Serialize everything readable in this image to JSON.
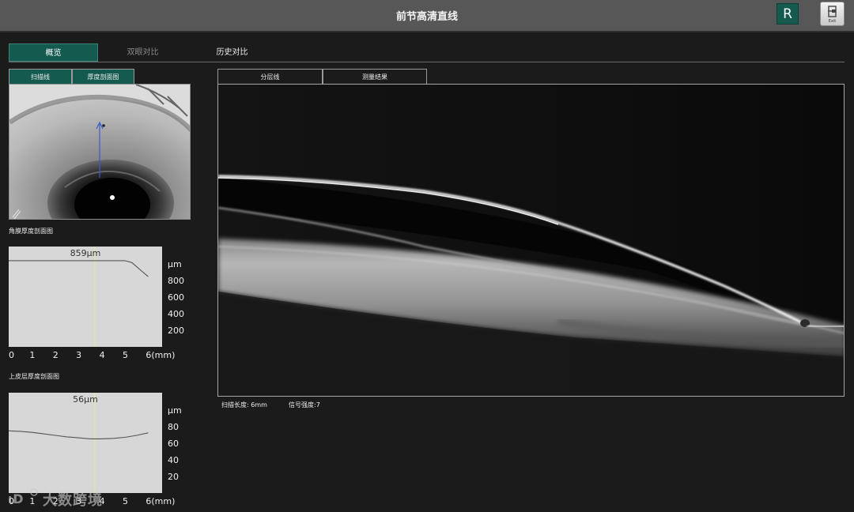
{
  "header": {
    "title": "前节高清直线",
    "eye_badge": "R",
    "exit_label": "Exit"
  },
  "tabs": {
    "overview": "概览",
    "binocular": "双眼对比",
    "history": "历史对比"
  },
  "left_subtabs": {
    "scan_line": "扫描线",
    "thickness_profile": "厚度剖面图"
  },
  "right_subtabs": {
    "layer_line": "分层线",
    "measure_result": "测量结果"
  },
  "colors": {
    "accent": "#145a4f",
    "header_bg": "#575757",
    "background": "#1b1b1b",
    "chart_bg": "#d7d7d7",
    "cursor_line": "#e8e3a0"
  },
  "chart_data": [
    {
      "type": "line",
      "title": "角膜厚度剖面图",
      "readout": "859μm",
      "unit_label": "μm",
      "x_tick_labels": [
        "0",
        "1",
        "2",
        "3",
        "4",
        "5",
        "6(mm)"
      ],
      "y_tick_labels": [
        "800",
        "600",
        "400",
        "200"
      ],
      "x": [
        0,
        0.5,
        1,
        1.5,
        2,
        2.5,
        3,
        3.5,
        4,
        4.5,
        5,
        5.3,
        5.7,
        6
      ],
      "y": [
        859,
        859,
        859,
        859,
        859,
        859,
        859,
        859,
        859,
        859,
        859,
        840,
        760,
        700
      ],
      "cursor_x": 3.7,
      "xlim": [
        0,
        6.6
      ],
      "ylim": [
        0,
        1000
      ],
      "grid": false
    },
    {
      "type": "line",
      "title": "上皮层厚度剖面图",
      "readout": "56μm",
      "unit_label": "μm",
      "x_tick_labels": [
        "0",
        "1",
        "2",
        "3",
        "4",
        "5",
        "6(mm)"
      ],
      "y_tick_labels": [
        "80",
        "60",
        "40",
        "20"
      ],
      "x": [
        0,
        0.5,
        1,
        1.5,
        2,
        2.5,
        3,
        3.5,
        4,
        4.5,
        5,
        5.5,
        6
      ],
      "y": [
        62,
        61.5,
        60.5,
        59,
        57.5,
        56,
        55,
        54,
        54,
        54.5,
        55.5,
        57.5,
        60
      ],
      "cursor_x": 3.7,
      "xlim": [
        0,
        6.6
      ],
      "ylim": [
        0,
        100
      ],
      "grid": false
    }
  ],
  "scan_info": {
    "scan_length": "扫描长度:  6mm",
    "signal_strength": "信号强度:7"
  },
  "watermark": {
    "text": "大数跨境"
  }
}
